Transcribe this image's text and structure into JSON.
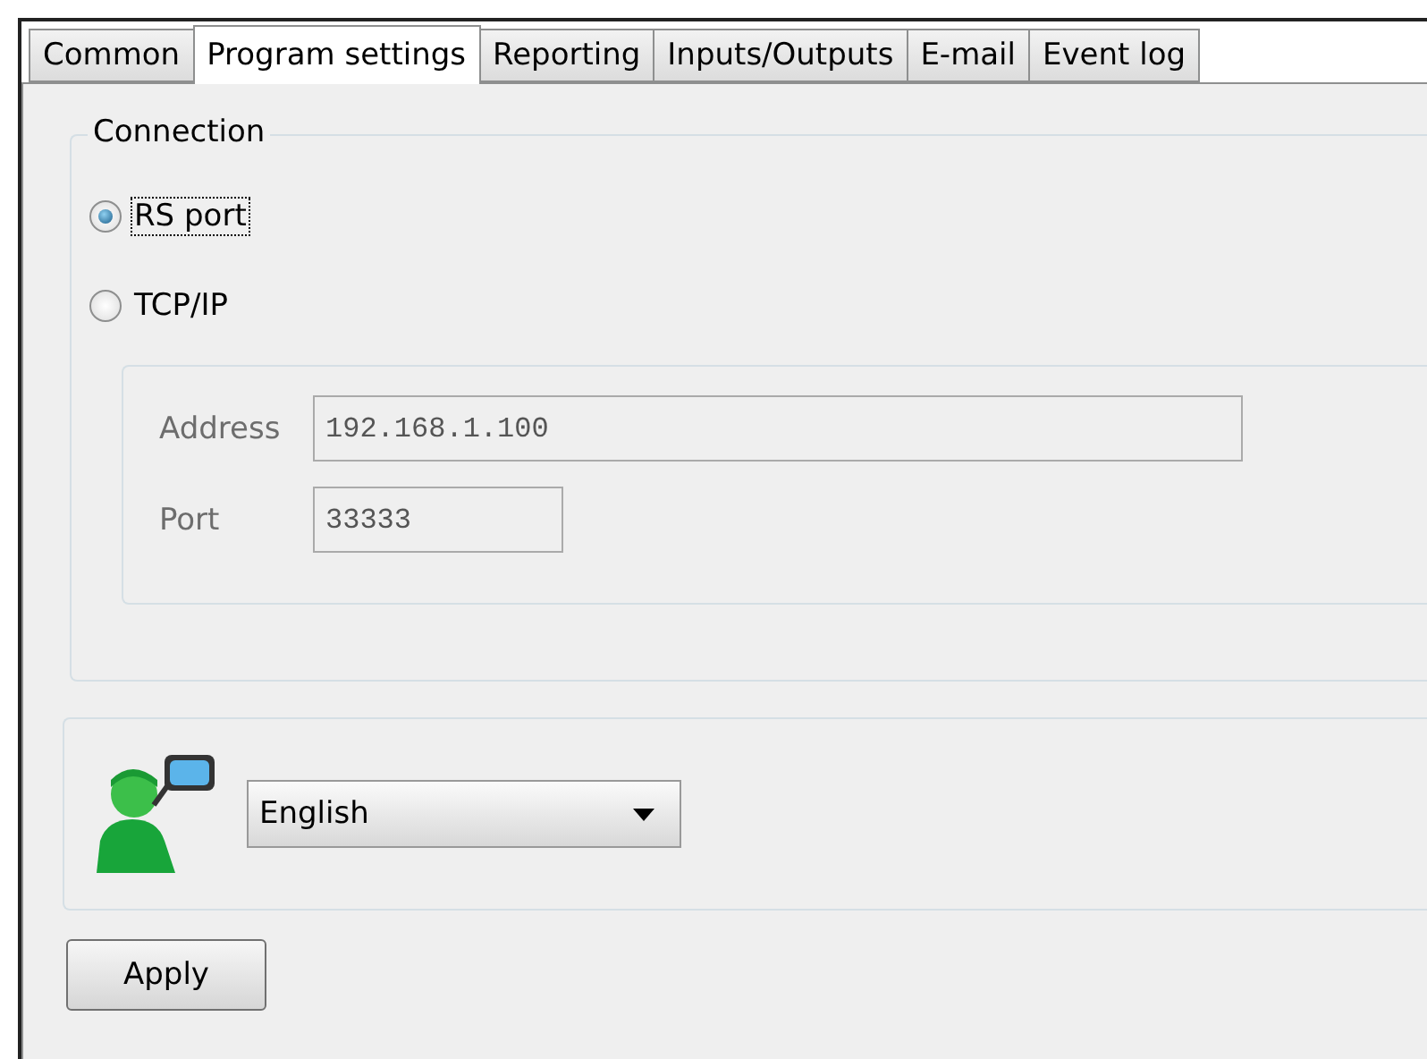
{
  "tabs": [
    {
      "label": "Common",
      "selected": false
    },
    {
      "label": "Program settings",
      "selected": true
    },
    {
      "label": "Reporting",
      "selected": false
    },
    {
      "label": "Inputs/Outputs",
      "selected": false
    },
    {
      "label": "E-mail",
      "selected": false
    },
    {
      "label": "Event log",
      "selected": false
    }
  ],
  "connection": {
    "title": "Connection",
    "options": [
      {
        "label": "RS port",
        "selected": true,
        "focused": true
      },
      {
        "label": "TCP/IP",
        "selected": false,
        "focused": false
      }
    ],
    "fields": [
      {
        "label": "Address",
        "value": "192.168.1.100",
        "disabled": true,
        "kind": "wide"
      },
      {
        "label": "Port",
        "value": "33333",
        "disabled": true,
        "kind": "narrow"
      }
    ]
  },
  "language": {
    "value": "English"
  },
  "buttons": [
    "Apply"
  ]
}
